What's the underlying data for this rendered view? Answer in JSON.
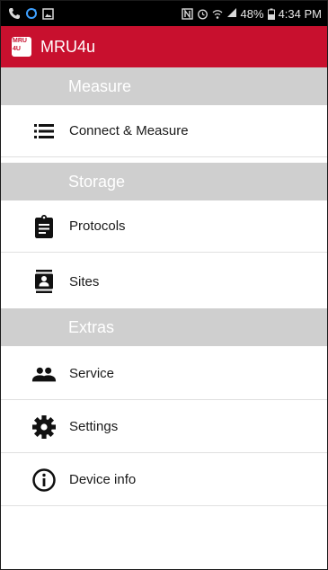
{
  "status_bar": {
    "battery": "48%",
    "time": "4:34 PM",
    "left_icons": [
      "phone-icon",
      "sync-icon",
      "image-icon"
    ],
    "right_icons": [
      "nfc-icon",
      "alarm-icon",
      "wifi-icon",
      "signal-icon",
      "battery-icon"
    ]
  },
  "app_bar": {
    "logo_line1": "MRU",
    "logo_line2": "4U",
    "title": "MRU4u",
    "color": "#c8102e"
  },
  "menu": {
    "sections": [
      {
        "header": "Measure",
        "items": [
          {
            "label": "Connect & Measure",
            "icon": "list-icon"
          }
        ]
      },
      {
        "header": "Storage",
        "items": [
          {
            "label": "Protocols",
            "icon": "clipboard-icon"
          },
          {
            "label": "Sites",
            "icon": "contact-card-icon"
          }
        ]
      },
      {
        "header": "Extras",
        "items": [
          {
            "label": "Service",
            "icon": "people-icon"
          },
          {
            "label": "Settings",
            "icon": "gear-icon"
          },
          {
            "label": "Device info",
            "icon": "info-icon"
          }
        ]
      }
    ]
  }
}
